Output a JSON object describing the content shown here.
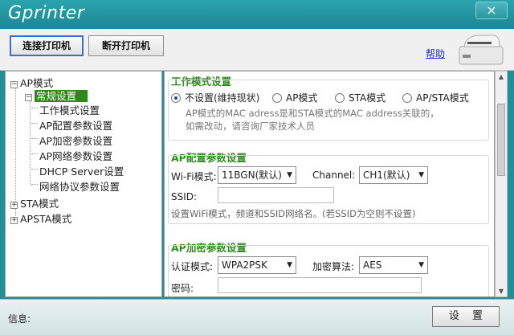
{
  "window": {
    "title": "Gprinter",
    "close_icon": "×"
  },
  "toolbar": {
    "connect_label": "连接打印机",
    "disconnect_label": "断开打印机",
    "help_label": "帮助"
  },
  "tree": {
    "ap": {
      "label": "AP模式",
      "expander": "−"
    },
    "general": {
      "label": "常规设置",
      "expander": "−"
    },
    "children": [
      "工作模式设置",
      "AP配置参数设置",
      "AP加密参数设置",
      "AP网络参数设置",
      "DHCP Server设置",
      "网络协议参数设置"
    ],
    "sta": {
      "label": "STA模式",
      "expander": "+"
    },
    "apsta": {
      "label": "APSTA模式",
      "expander": "+"
    }
  },
  "work_mode": {
    "title": "工作模式设置",
    "options": [
      "不设置(维持现状)",
      "AP模式",
      "STA模式",
      "AP/STA模式"
    ],
    "selected": 0,
    "note_line1": "AP模式的MAC adress是和STA模式的MAC address关联的，",
    "note_line2": "如需改动，请咨询厂家技术人员"
  },
  "ap_config": {
    "title": "AP配置参数设置",
    "wifi_mode_label": "Wi-Fi模式:",
    "wifi_mode_value": "11BGN(默认)",
    "channel_label": "Channel:",
    "channel_value": "CH1(默认)",
    "ssid_label": "SSID:",
    "ssid_value": "",
    "note": "设置WiFi模式，频道和SSID网络名。(若SSID为空则不设置)"
  },
  "ap_encrypt": {
    "title": "AP加密参数设置",
    "auth_label": "认证模式:",
    "auth_value": "WPA2PSK",
    "algo_label": "加密算法:",
    "algo_value": "AES",
    "password_label": "密码:",
    "password_value": ""
  },
  "status": {
    "label": "信息:"
  },
  "footer": {
    "set_label": "设 置"
  }
}
